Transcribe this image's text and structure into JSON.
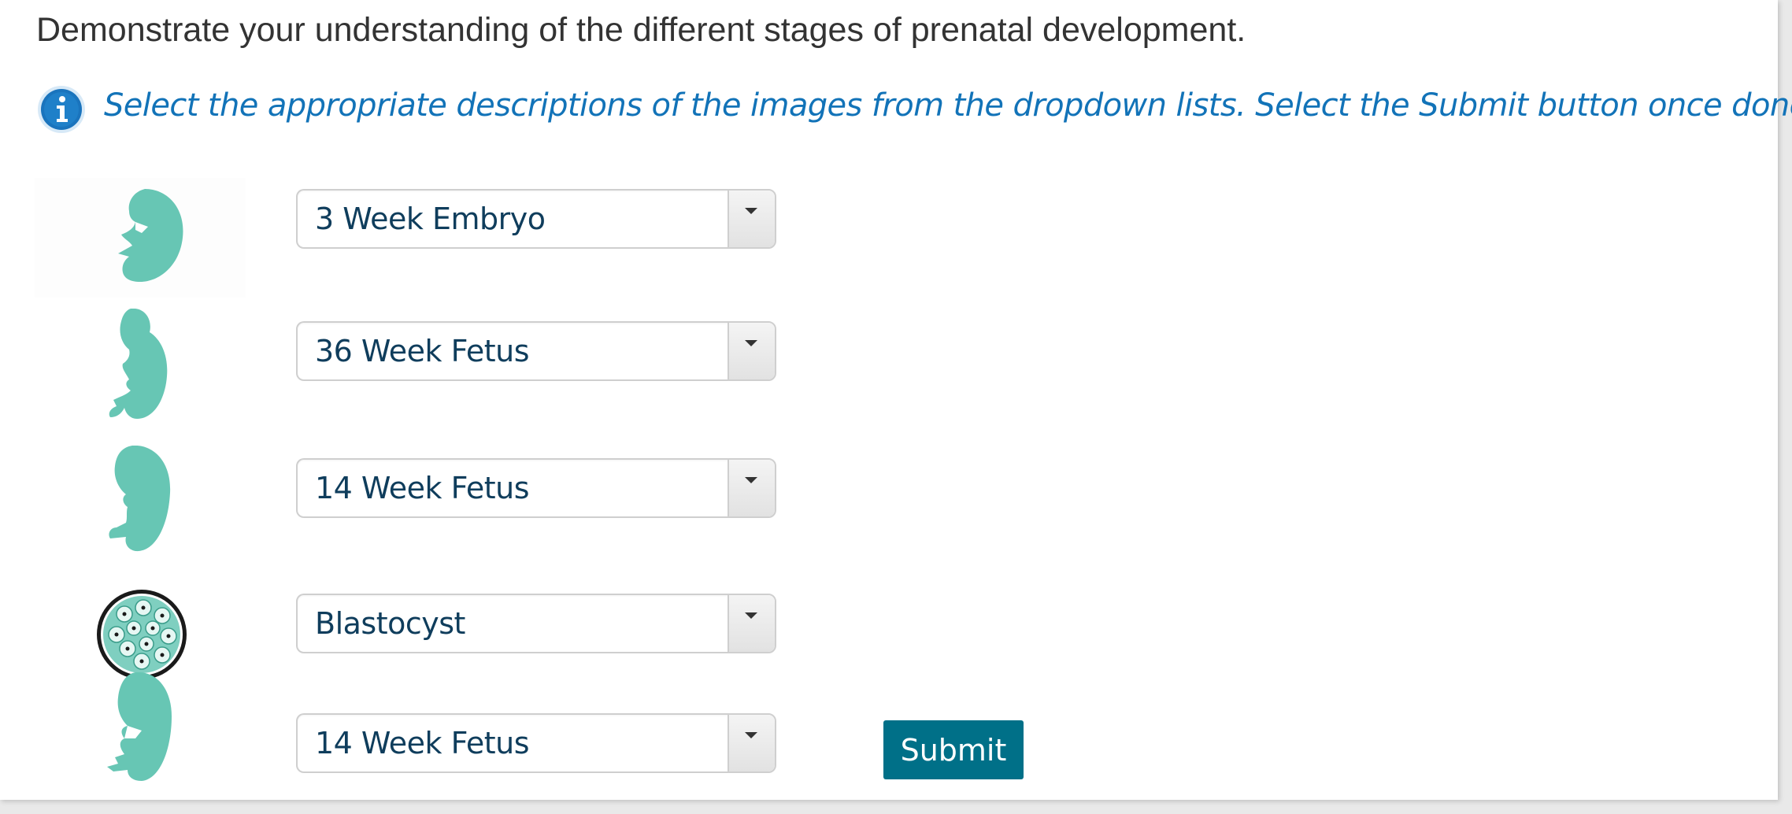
{
  "prompt": "Demonstrate your understanding of the different stages of prenatal development.",
  "instruction": "Select the appropriate descriptions of the images from the dropdown lists. Select the Submit button once done.",
  "items": [
    {
      "image": "embryo-icon",
      "selected": "3 Week Embryo"
    },
    {
      "image": "fetus-icon",
      "selected": "36 Week Fetus"
    },
    {
      "image": "fetus-icon",
      "selected": "14 Week Fetus"
    },
    {
      "image": "blastocyst-icon",
      "selected": "Blastocyst"
    },
    {
      "image": "embryo-icon",
      "selected": "14 Week Fetus"
    }
  ],
  "submit_label": "Submit",
  "colors": {
    "accent": "#007088",
    "instruction": "#1273b8",
    "figure": "#67c6b4",
    "select_text": "#0f3d5c"
  }
}
